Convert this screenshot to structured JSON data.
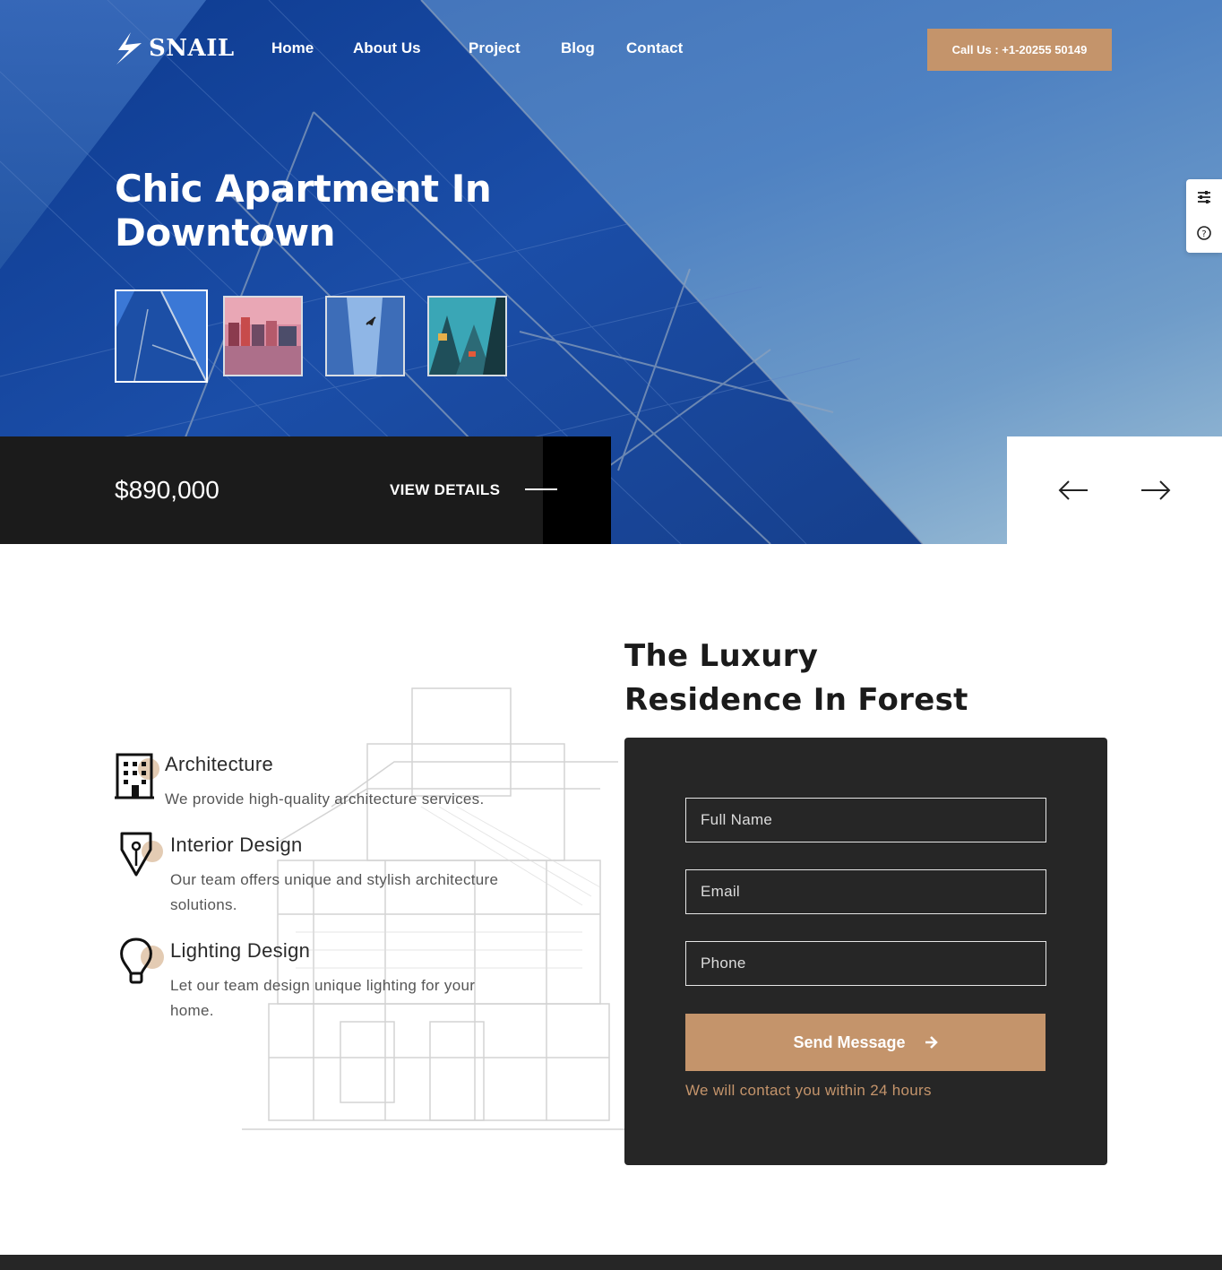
{
  "brand": {
    "name": "SNAIL",
    "accent": "#c4946b"
  },
  "nav": {
    "items": [
      {
        "label": "Home"
      },
      {
        "label": "About Us"
      },
      {
        "label": "Project"
      },
      {
        "label": "Blog"
      },
      {
        "label": "Contact"
      }
    ],
    "call_label": "Call Us : +1-20255 50149"
  },
  "side_tools": {
    "icons": [
      "sliders-icon",
      "help-circle-icon"
    ]
  },
  "hero": {
    "title_line1": "Chic Apartment In",
    "title_line2": "Downtown",
    "thumbnails": [
      "glass-building",
      "waterfront-city",
      "skyscrapers-plane",
      "city-towers-lookup"
    ],
    "price": "$890,000",
    "view_details": "VIEW DETAILS"
  },
  "features": [
    {
      "title": "Architecture",
      "desc_line1": "We provide high-quality architecture services.",
      "desc_line2": "",
      "icon": "building-icon"
    },
    {
      "title": "Interior Design",
      "desc_line1": "Our team offers unique and stylish architecture",
      "desc_line2": "solutions.",
      "icon": "pen-nib-icon"
    },
    {
      "title": "Lighting Design",
      "desc_line1": "Let our team design unique lighting for your",
      "desc_line2": "home.",
      "icon": "light-bulb-icon"
    }
  ],
  "section": {
    "title_line1": "The Luxury",
    "title_line2": "Residence In Forest"
  },
  "form": {
    "name_placeholder": "Full Name",
    "email_placeholder": "Email",
    "phone_placeholder": "Phone",
    "submit_label": "Send Message",
    "note": "We will contact you within 24 hours"
  }
}
